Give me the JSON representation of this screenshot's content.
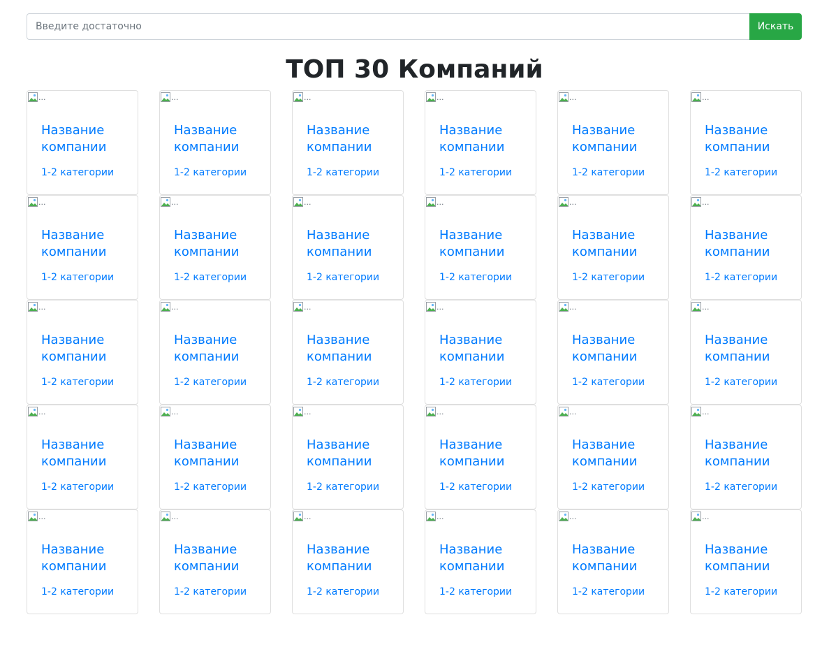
{
  "search": {
    "placeholder": "Введите достаточно",
    "button_label": "Искать"
  },
  "title": "ТОП 30 Компаний",
  "cards": [
    {
      "img_alt": "...",
      "name": "Название компании",
      "category": "1-2 категории"
    },
    {
      "img_alt": "...",
      "name": "Название компании",
      "category": "1-2 категории"
    },
    {
      "img_alt": "...",
      "name": "Название компании",
      "category": "1-2 категории"
    },
    {
      "img_alt": "...",
      "name": "Название компании",
      "category": "1-2 категории"
    },
    {
      "img_alt": "...",
      "name": "Название компании",
      "category": "1-2 категории"
    },
    {
      "img_alt": "...",
      "name": "Название компании",
      "category": "1-2 категории"
    },
    {
      "img_alt": "...",
      "name": "Название компании",
      "category": "1-2 категории"
    },
    {
      "img_alt": "...",
      "name": "Название компании",
      "category": "1-2 категории"
    },
    {
      "img_alt": "...",
      "name": "Название компании",
      "category": "1-2 категории"
    },
    {
      "img_alt": "...",
      "name": "Название компании",
      "category": "1-2 категории"
    },
    {
      "img_alt": "...",
      "name": "Название компании",
      "category": "1-2 категории"
    },
    {
      "img_alt": "...",
      "name": "Название компании",
      "category": "1-2 категории"
    },
    {
      "img_alt": "...",
      "name": "Название компании",
      "category": "1-2 категории"
    },
    {
      "img_alt": "...",
      "name": "Название компании",
      "category": "1-2 категории"
    },
    {
      "img_alt": "...",
      "name": "Название компании",
      "category": "1-2 категории"
    },
    {
      "img_alt": "...",
      "name": "Название компании",
      "category": "1-2 категории"
    },
    {
      "img_alt": "...",
      "name": "Название компании",
      "category": "1-2 категории"
    },
    {
      "img_alt": "...",
      "name": "Название компании",
      "category": "1-2 категории"
    },
    {
      "img_alt": "...",
      "name": "Название компании",
      "category": "1-2 категории"
    },
    {
      "img_alt": "...",
      "name": "Название компании",
      "category": "1-2 категории"
    },
    {
      "img_alt": "...",
      "name": "Название компании",
      "category": "1-2 категории"
    },
    {
      "img_alt": "...",
      "name": "Название компании",
      "category": "1-2 категории"
    },
    {
      "img_alt": "...",
      "name": "Название компании",
      "category": "1-2 категории"
    },
    {
      "img_alt": "...",
      "name": "Название компании",
      "category": "1-2 категории"
    },
    {
      "img_alt": "...",
      "name": "Название компании",
      "category": "1-2 категории"
    },
    {
      "img_alt": "...",
      "name": "Название компании",
      "category": "1-2 категории"
    },
    {
      "img_alt": "...",
      "name": "Название компании",
      "category": "1-2 категории"
    },
    {
      "img_alt": "...",
      "name": "Название компании",
      "category": "1-2 категории"
    },
    {
      "img_alt": "...",
      "name": "Название компании",
      "category": "1-2 категории"
    },
    {
      "img_alt": "...",
      "name": "Название компании",
      "category": "1-2 категории"
    }
  ],
  "colors": {
    "accent_link": "#007bff",
    "button_success": "#28a745",
    "title_text": "#212529",
    "card_border": "#dfdfdf"
  },
  "icons": {
    "card_image": "broken-image-icon"
  }
}
